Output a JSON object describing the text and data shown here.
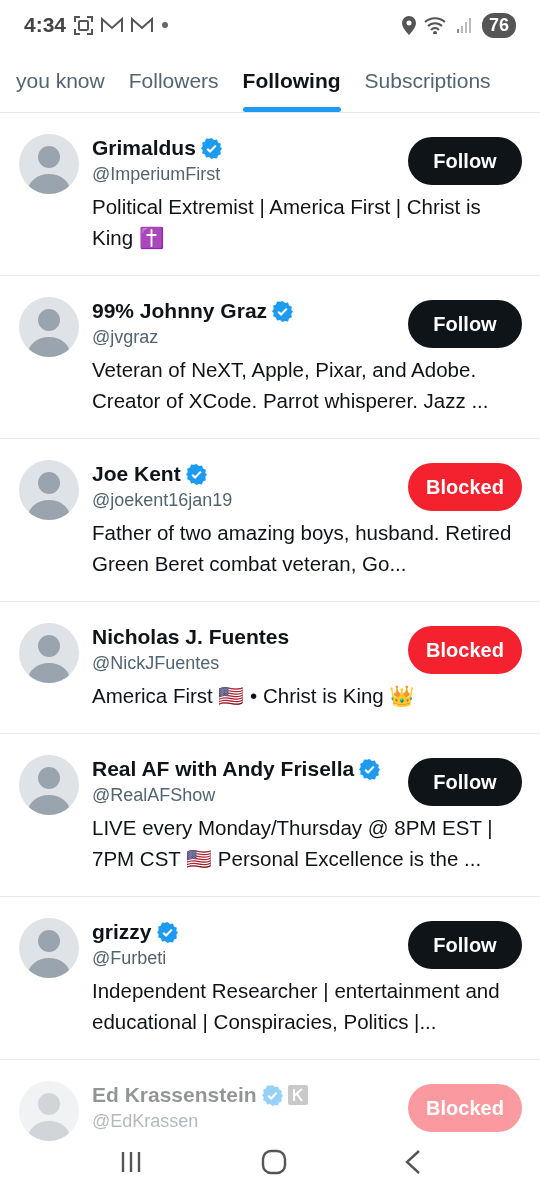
{
  "status_bar": {
    "time": "4:34",
    "battery": "76"
  },
  "tabs": [
    {
      "label": "you know",
      "selected": false
    },
    {
      "label": "Followers",
      "selected": false
    },
    {
      "label": "Following",
      "selected": true
    },
    {
      "label": "Subscriptions",
      "selected": false
    }
  ],
  "accounts": [
    {
      "name": "Grimaldus",
      "verified": true,
      "handle": "@ImperiumFirst",
      "bio": "Political Extremist | America First | Christ is King ✝️",
      "button": {
        "kind": "follow",
        "label": "Follow"
      },
      "faded": false
    },
    {
      "name": "99% Johnny Graz",
      "verified": true,
      "handle": "@jvgraz",
      "bio": "Veteran of NeXT, Apple, Pixar, and Adobe. Creator of XCode. Parrot whisperer. Jazz ...",
      "button": {
        "kind": "follow",
        "label": "Follow"
      },
      "faded": false
    },
    {
      "name": "Joe Kent",
      "verified": true,
      "handle": "@joekent16jan19",
      "bio": "Father of two amazing boys, husband. Retired Green Beret combat veteran, Go...",
      "button": {
        "kind": "blocked",
        "label": "Blocked"
      },
      "faded": false
    },
    {
      "name": "Nicholas J. Fuentes",
      "verified": false,
      "handle": "@NickJFuentes",
      "bio": "America First 🇺🇸 • Christ is King 👑",
      "button": {
        "kind": "blocked",
        "label": "Blocked"
      },
      "faded": false
    },
    {
      "name": "Real AF with Andy Frisella",
      "verified": true,
      "handle": "@RealAFShow",
      "bio": "LIVE every Monday/Thursday @ 8PM EST | 7PM CST 🇺🇸 Personal Excellence is the ...",
      "button": {
        "kind": "follow",
        "label": "Follow"
      },
      "faded": false
    },
    {
      "name": "grizzy",
      "verified": true,
      "handle": "@Furbeti",
      "bio": "Independent Researcher | entertainment and educational | Conspiracies, Politics |...",
      "button": {
        "kind": "follow",
        "label": "Follow"
      },
      "faded": false
    },
    {
      "name": "Ed Krassenstein",
      "verified": true,
      "handle": "@EdKrassen",
      "button": {
        "kind": "blocked",
        "label": "Blocked"
      },
      "faded": true
    }
  ]
}
